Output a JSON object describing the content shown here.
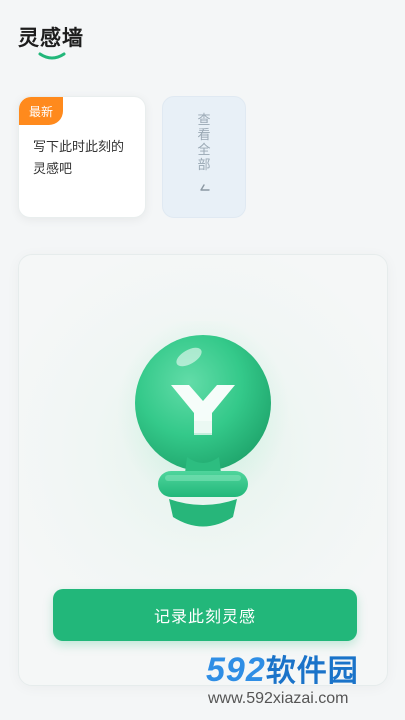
{
  "header": {
    "title": "灵感墙"
  },
  "cards": {
    "latest": {
      "badge": "最新",
      "text": "写下此时此刻的灵感吧"
    },
    "view_all": {
      "label": "查看全部"
    }
  },
  "main": {
    "record_button": "记录此刻灵感"
  },
  "icons": {
    "arrow": "arrow-icon",
    "bulb": "lightbulb-icon"
  },
  "colors": {
    "accent": "#22b77a",
    "badge": "#ff8a1d",
    "bulb": "#34c98a"
  },
  "watermark": {
    "brand_num": "592",
    "brand_cn": "软件园",
    "url": "www.592xiazai.com"
  }
}
